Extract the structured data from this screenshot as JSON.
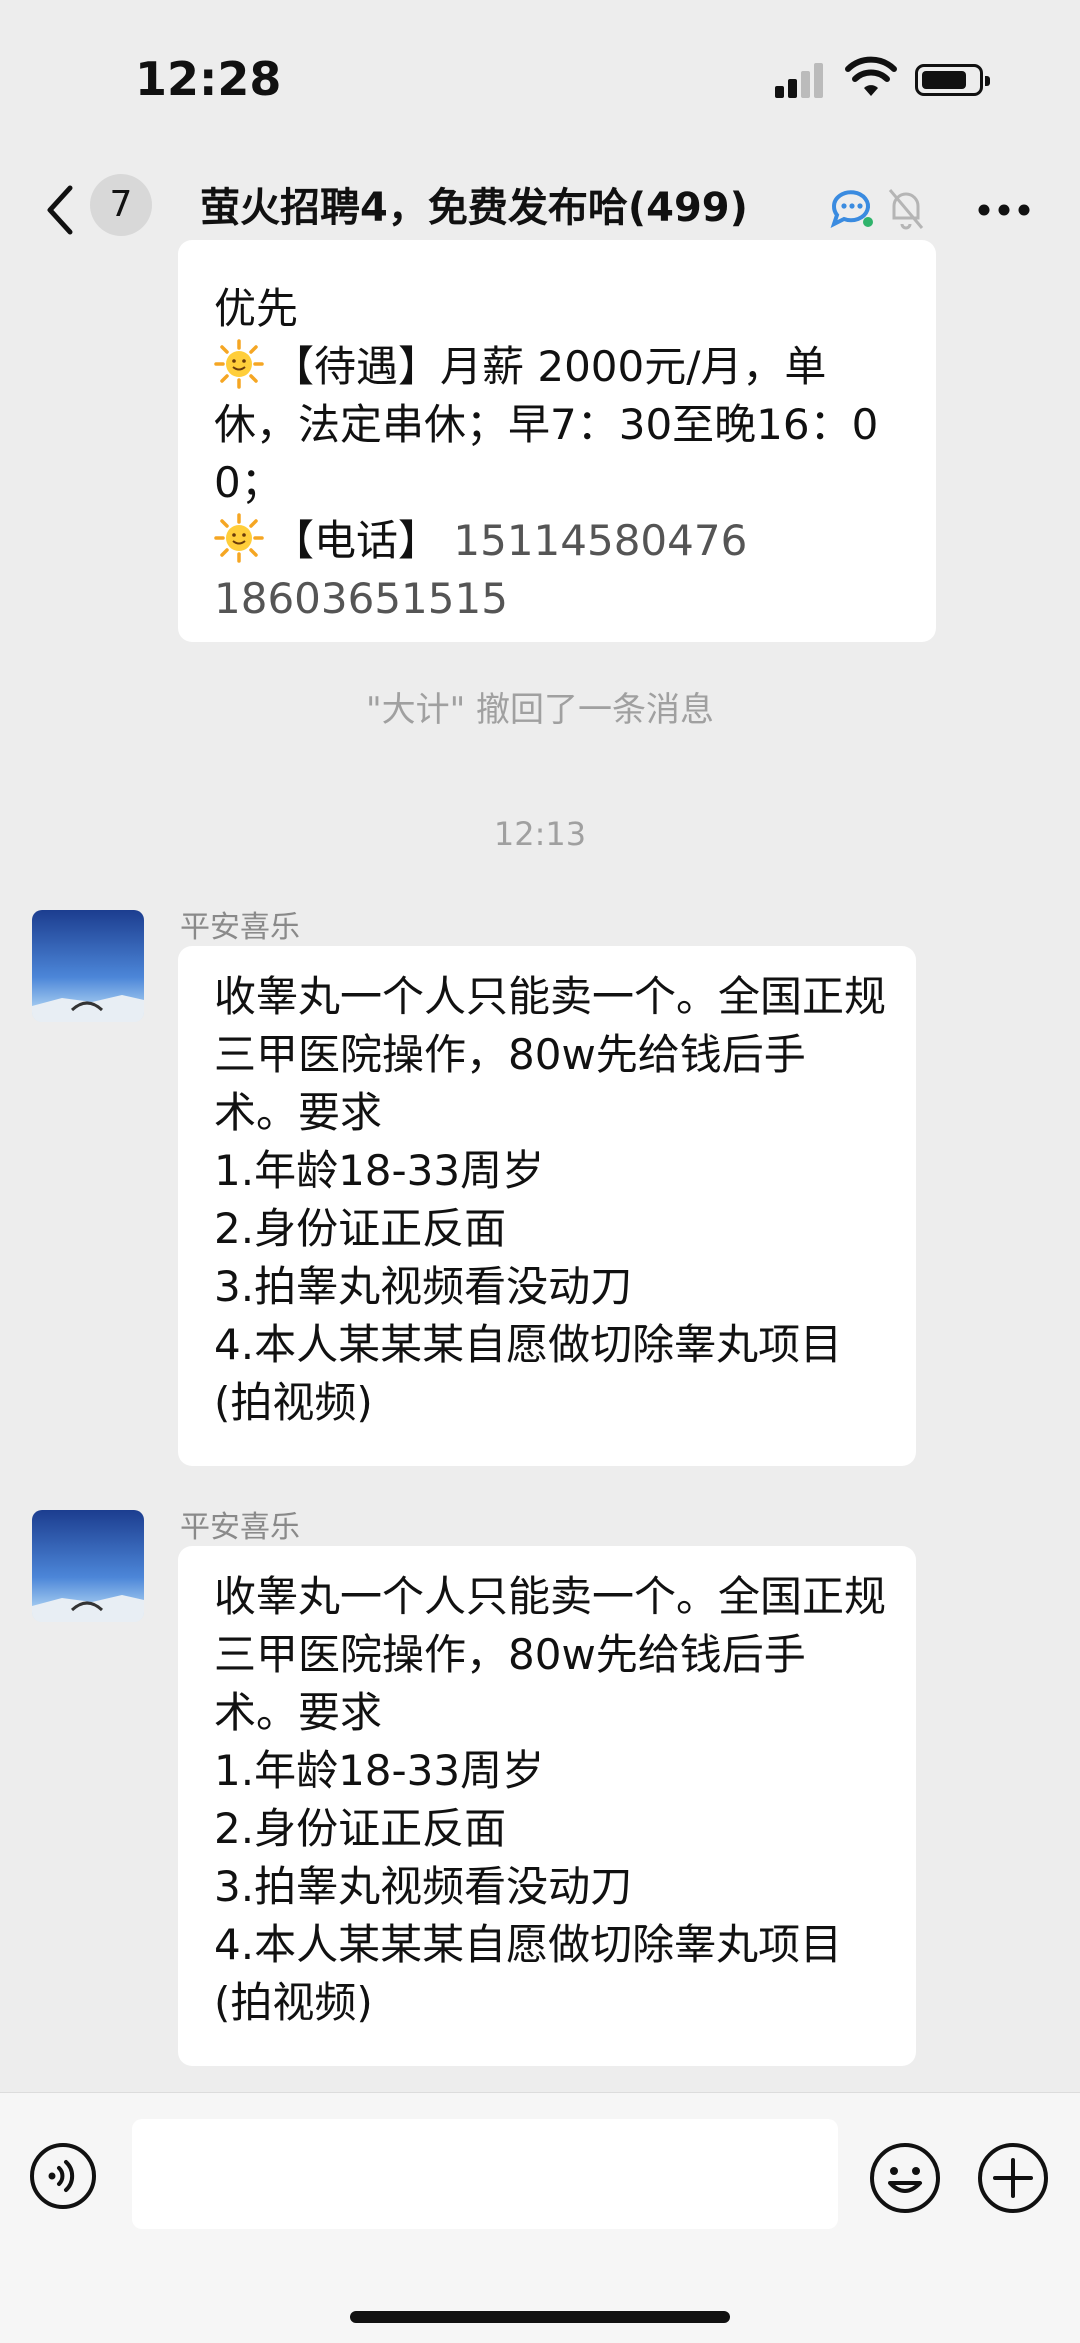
{
  "status_bar": {
    "time": "12:28"
  },
  "nav": {
    "unread_count": "7",
    "title": "萤火招聘4，免费发布哈",
    "member_count": "(499)"
  },
  "messages": {
    "first_bubble": {
      "line1": "优先",
      "line2": "【待遇】月薪 2000元/月，单休，法定串休；早7：30至晚16：00；",
      "line3_label": "【电话】",
      "phone1": "15114580476",
      "phone2": "18603651515"
    },
    "recall_notice": "\"大计\" 撤回了一条消息",
    "timestamp": "12:13",
    "items": [
      {
        "sender": "平安喜乐",
        "text": "收睾丸一个人只能卖一个。全国正规三甲医院操作，80w先给钱后手术。要求\n1.年龄18-33周岁\n2.身份证正反面\n3.拍睾丸视频看没动刀\n4.本人某某某自愿做切除睾丸项目(拍视频)"
      },
      {
        "sender": "平安喜乐",
        "text": "收睾丸一个人只能卖一个。全国正规三甲医院操作，80w先给钱后手术。要求\n1.年龄18-33周岁\n2.身份证正反面\n3.拍睾丸视频看没动刀\n4.本人某某某自愿做切除睾丸项目(拍视频)"
      }
    ]
  },
  "icons": {
    "back": "back-icon",
    "chat": "chat-bubble-icon",
    "mute": "bell-muted-icon",
    "more": "more-icon",
    "voice": "voice-icon",
    "emoji": "emoji-icon",
    "plus": "plus-icon",
    "sun": "sun-emoji-icon"
  }
}
